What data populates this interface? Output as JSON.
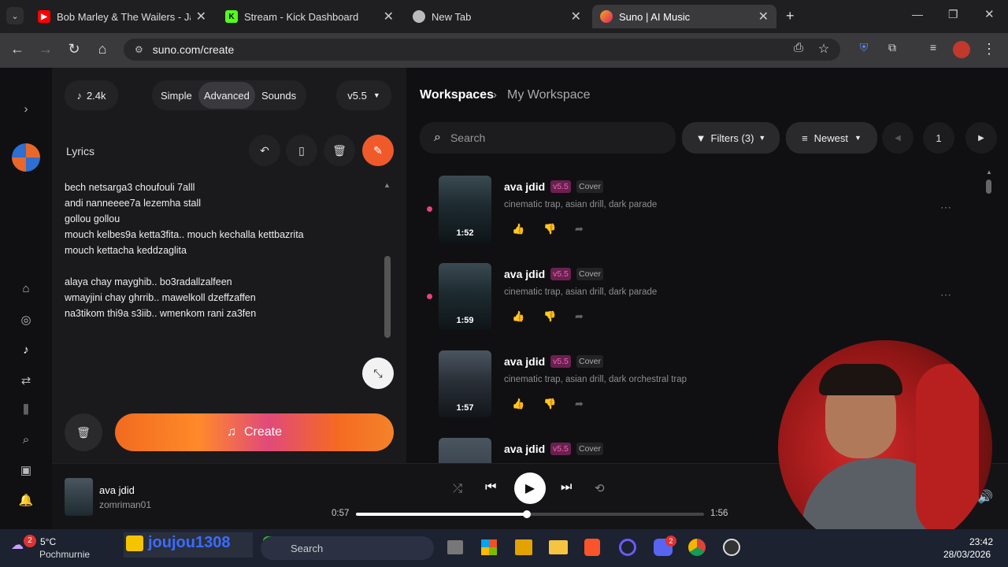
{
  "tabs": [
    {
      "title": "Bob Marley & The Wailers - Jam",
      "icon": "youtube-icon"
    },
    {
      "title": "Stream - Kick Dashboard",
      "icon": "kick-icon"
    },
    {
      "title": "New Tab",
      "icon": "chrome-icon"
    },
    {
      "title": "Suno | AI Music",
      "icon": "suno-icon",
      "active": true
    }
  ],
  "address": {
    "url": "suno.com/create"
  },
  "header": {
    "credits": "2.4k",
    "modes": [
      "Simple",
      "Advanced",
      "Sounds"
    ],
    "active_mode": "Advanced",
    "version": "v5.5"
  },
  "lyrics": {
    "label": "Lyrics",
    "lines": [
      "bech netsarga3 choufouli 7alll",
      "andi nanneeee7a lezemha stall",
      "gollou gollou",
      "mouch kelbes9a ketta3fita.. mouch kechalla kettbazrita",
      "mouch kettacha keddzaglita",
      "",
      "alaya chay mayghib..  bo3radallzalfeen",
      "wmayjini chay ghrrib.. mawelkoll dzeffzaffen",
      "na3tikom thi9a s3iib..  wmenkom rani za3fen"
    ]
  },
  "create": {
    "label": "Create"
  },
  "workspace": {
    "root": "Workspaces",
    "current": "My Workspace",
    "search_placeholder": "Search",
    "filters": "Filters (3)",
    "sort": "Newest",
    "page": "1"
  },
  "songs": [
    {
      "title": "ava jdid",
      "version": "v5.5",
      "kind": "Cover",
      "tags": "cinematic trap, asian drill, dark parade",
      "duration": "1:52",
      "playing": true
    },
    {
      "title": "ava jdid",
      "version": "v5.5",
      "kind": "Cover",
      "tags": "cinematic trap, asian drill, dark parade",
      "duration": "1:59",
      "playing": true
    },
    {
      "title": "ava jdid",
      "version": "v5.5",
      "kind": "Cover",
      "tags": "cinematic trap, asian drill, dark orchestral trap",
      "duration": "1:57",
      "playing": false
    },
    {
      "title": "ava jdid",
      "version": "v5.5",
      "kind": "Cover",
      "tags": "",
      "duration": "",
      "playing": false
    }
  ],
  "player": {
    "title": "ava jdid",
    "artist": "zomriman01",
    "elapsed": "0:57",
    "total": "1:56",
    "progress": 0.49
  },
  "taskbar": {
    "temp": "5°C",
    "weather": "Pochmurnie",
    "weather_badge": "2",
    "streamer": "joujou1308",
    "search": "Search",
    "time": "23:42",
    "date": "28/03/2026",
    "discord_badge": "2"
  },
  "colors": {
    "accent": "#f26a1f",
    "pink": "#e8437a",
    "version_badge": "#6a2050"
  }
}
